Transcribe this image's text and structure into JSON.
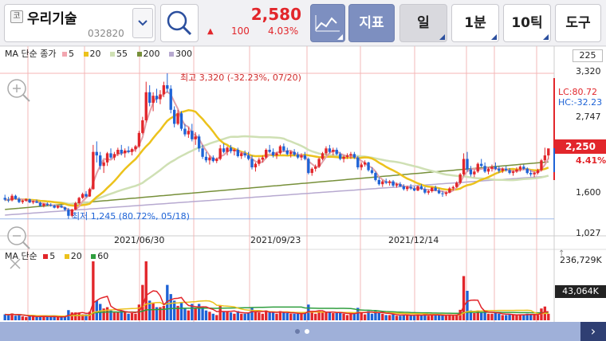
{
  "toolbar": {
    "market_badge": "코",
    "stock_name": "우리기술",
    "stock_code": "032820",
    "price": "2,580",
    "change_arrow": "▲",
    "change_value": "100",
    "change_percent": "4.03%",
    "indicator_label": "지표",
    "period_day_label": "일",
    "period_minute_label": "1분",
    "period_tick_label": "10틱",
    "tools_label": "도구"
  },
  "colors": {
    "up": "#e2262b",
    "down": "#1e63d6",
    "ma5": "#e3a0a8",
    "ma20": "#ecc21c",
    "ma55": "#cfe0b4",
    "ma200": "#77903a",
    "ma300": "#b7a9d0",
    "vma5": "#e2262b",
    "vma20": "#ecc21c",
    "vma60": "#2f9e3e"
  },
  "ma_legend": {
    "title": "MA 단순 종가",
    "items": [
      {
        "label": "5",
        "color": "#f2a6b0"
      },
      {
        "label": "20",
        "color": "#ecc21c"
      },
      {
        "label": "55",
        "color": "#cfe0b4"
      },
      {
        "label": "200",
        "color": "#77903a"
      },
      {
        "label": "300",
        "color": "#b7a9d0"
      }
    ]
  },
  "vol_legend": {
    "title": "MA 단순",
    "items": [
      {
        "label": "5",
        "color": "#e2262b"
      },
      {
        "label": "20",
        "color": "#ecc21c"
      },
      {
        "label": "60",
        "color": "#2f9e3e"
      }
    ]
  },
  "price_axis": {
    "top_value": "225",
    "ticks": [
      "3,320",
      "2,747",
      "1,600",
      "1,027"
    ],
    "current_price": "2,250",
    "current_percent": "4.41%",
    "lc_label": "LC:80.72",
    "hc_label": "HC:-32.23"
  },
  "volume_axis": {
    "max_value": "236,729K",
    "current_value": "43,064K"
  },
  "annotations": {
    "high": "최고 3,320 (-32.23%, 07/20)",
    "low": "최저 1,245 (80.72%, 05/18)"
  },
  "x_axis": {
    "labels": [
      "2021/06/30",
      "2021/09/23",
      "2021/12/14"
    ]
  },
  "chart_data": {
    "type": "candlestick",
    "price_range": [
      1027,
      3320
    ],
    "high": 3320,
    "low": 1245,
    "last_close": 2250,
    "candles": [
      [
        1545,
        1590,
        1500,
        1520
      ],
      [
        1520,
        1560,
        1480,
        1510
      ],
      [
        1510,
        1600,
        1495,
        1575
      ],
      [
        1575,
        1590,
        1520,
        1530
      ],
      [
        1530,
        1555,
        1470,
        1485
      ],
      [
        1485,
        1520,
        1460,
        1505
      ],
      [
        1505,
        1540,
        1490,
        1525
      ],
      [
        1525,
        1535,
        1470,
        1480
      ],
      [
        1480,
        1510,
        1455,
        1495
      ],
      [
        1495,
        1520,
        1470,
        1475
      ],
      [
        1475,
        1490,
        1420,
        1430
      ],
      [
        1430,
        1470,
        1410,
        1460
      ],
      [
        1460,
        1480,
        1430,
        1445
      ],
      [
        1445,
        1470,
        1420,
        1435
      ],
      [
        1435,
        1450,
        1395,
        1405
      ],
      [
        1405,
        1440,
        1390,
        1430
      ],
      [
        1430,
        1450,
        1400,
        1410
      ],
      [
        1410,
        1420,
        1360,
        1375
      ],
      [
        1375,
        1400,
        1245,
        1290
      ],
      [
        1290,
        1390,
        1270,
        1380
      ],
      [
        1380,
        1490,
        1370,
        1470
      ],
      [
        1470,
        1560,
        1450,
        1545
      ],
      [
        1545,
        1620,
        1530,
        1600
      ],
      [
        1600,
        1640,
        1550,
        1565
      ],
      [
        1565,
        1690,
        1560,
        1670
      ],
      [
        1670,
        2300,
        1660,
        2200
      ],
      [
        2200,
        2350,
        2050,
        2150
      ],
      [
        2150,
        2200,
        1950,
        2000
      ],
      [
        2000,
        2080,
        1900,
        2050
      ],
      [
        2050,
        2200,
        2000,
        2180
      ],
      [
        2180,
        2250,
        2100,
        2120
      ],
      [
        2120,
        2200,
        2080,
        2170
      ],
      [
        2170,
        2260,
        2140,
        2230
      ],
      [
        2230,
        2300,
        2150,
        2180
      ],
      [
        2180,
        2250,
        2120,
        2220
      ],
      [
        2220,
        2280,
        2180,
        2200
      ],
      [
        2200,
        2260,
        2150,
        2240
      ],
      [
        2240,
        2300,
        2200,
        2280
      ],
      [
        2280,
        2500,
        2260,
        2470
      ],
      [
        2470,
        2700,
        2450,
        2650
      ],
      [
        2650,
        3200,
        2620,
        3050
      ],
      [
        3050,
        3150,
        2850,
        2900
      ],
      [
        2900,
        3050,
        2780,
        3000
      ],
      [
        3000,
        3100,
        2900,
        2950
      ],
      [
        2950,
        3080,
        2880,
        3020
      ],
      [
        3020,
        3200,
        2980,
        3150
      ],
      [
        3150,
        3320,
        3050,
        3100
      ],
      [
        3100,
        3150,
        2750,
        2800
      ],
      [
        2800,
        2850,
        2550,
        2600
      ],
      [
        2600,
        2800,
        2580,
        2750
      ],
      [
        2750,
        2780,
        2500,
        2530
      ],
      [
        2530,
        2600,
        2420,
        2450
      ],
      [
        2450,
        2550,
        2400,
        2500
      ],
      [
        2500,
        2600,
        2350,
        2380
      ],
      [
        2380,
        2480,
        2300,
        2420
      ],
      [
        2420,
        2450,
        2200,
        2250
      ],
      [
        2250,
        2300,
        2100,
        2130
      ],
      [
        2130,
        2200,
        2050,
        2080
      ],
      [
        2080,
        2150,
        2020,
        2120
      ],
      [
        2120,
        2150,
        2050,
        2070
      ],
      [
        2070,
        2120,
        2040,
        2100
      ],
      [
        2100,
        2300,
        2080,
        2250
      ],
      [
        2250,
        2320,
        2180,
        2200
      ],
      [
        2200,
        2280,
        2150,
        2260
      ],
      [
        2260,
        2300,
        2180,
        2210
      ],
      [
        2210,
        2250,
        2150,
        2230
      ],
      [
        2230,
        2260,
        2120,
        2140
      ],
      [
        2140,
        2200,
        2100,
        2180
      ],
      [
        2180,
        2220,
        2120,
        2150
      ],
      [
        2150,
        2200,
        2080,
        2100
      ],
      [
        2100,
        2150,
        1950,
        1980
      ],
      [
        1980,
        2050,
        1920,
        2030
      ],
      [
        2030,
        2120,
        2000,
        2090
      ],
      [
        2090,
        2150,
        2050,
        2120
      ],
      [
        2120,
        2250,
        2100,
        2230
      ],
      [
        2230,
        2300,
        2180,
        2200
      ],
      [
        2200,
        2250,
        2120,
        2150
      ],
      [
        2150,
        2200,
        2100,
        2180
      ],
      [
        2180,
        2300,
        2160,
        2280
      ],
      [
        2280,
        2320,
        2200,
        2220
      ],
      [
        2220,
        2260,
        2150,
        2170
      ],
      [
        2170,
        2220,
        2120,
        2200
      ],
      [
        2200,
        2240,
        2140,
        2160
      ],
      [
        2160,
        2200,
        2100,
        2120
      ],
      [
        2120,
        2180,
        2080,
        2150
      ],
      [
        2150,
        2200,
        2080,
        2100
      ],
      [
        2100,
        2120,
        1880,
        1900
      ],
      [
        1900,
        1980,
        1860,
        1960
      ],
      [
        1960,
        2020,
        1920,
        1990
      ],
      [
        1990,
        2120,
        1970,
        2100
      ],
      [
        2100,
        2200,
        2080,
        2180
      ],
      [
        2180,
        2280,
        2150,
        2250
      ],
      [
        2250,
        2300,
        2180,
        2200
      ],
      [
        2200,
        2260,
        2150,
        2230
      ],
      [
        2230,
        2260,
        2150,
        2170
      ],
      [
        2170,
        2200,
        2080,
        2100
      ],
      [
        2100,
        2150,
        2050,
        2130
      ],
      [
        2130,
        2180,
        2100,
        2150
      ],
      [
        2150,
        2200,
        2100,
        2170
      ],
      [
        2170,
        2200,
        2100,
        2120
      ],
      [
        2120,
        2140,
        1950,
        1980
      ],
      [
        1980,
        2050,
        1940,
        2020
      ],
      [
        2020,
        2080,
        1990,
        2050
      ],
      [
        2050,
        2060,
        1920,
        1940
      ],
      [
        1940,
        1980,
        1880,
        1900
      ],
      [
        1900,
        1920,
        1780,
        1800
      ],
      [
        1800,
        1840,
        1720,
        1740
      ],
      [
        1740,
        1800,
        1700,
        1780
      ],
      [
        1780,
        1820,
        1740,
        1760
      ],
      [
        1760,
        1800,
        1720,
        1780
      ],
      [
        1780,
        1800,
        1700,
        1720
      ],
      [
        1720,
        1760,
        1690,
        1740
      ],
      [
        1740,
        1770,
        1700,
        1710
      ],
      [
        1710,
        1740,
        1650,
        1670
      ],
      [
        1670,
        1720,
        1640,
        1700
      ],
      [
        1700,
        1740,
        1660,
        1680
      ],
      [
        1680,
        1710,
        1640,
        1650
      ],
      [
        1650,
        1720,
        1640,
        1710
      ],
      [
        1710,
        1740,
        1660,
        1670
      ],
      [
        1670,
        1700,
        1600,
        1620
      ],
      [
        1620,
        1660,
        1590,
        1640
      ],
      [
        1640,
        1700,
        1620,
        1690
      ],
      [
        1690,
        1720,
        1640,
        1650
      ],
      [
        1650,
        1680,
        1600,
        1610
      ],
      [
        1610,
        1640,
        1560,
        1600
      ],
      [
        1600,
        1640,
        1570,
        1620
      ],
      [
        1620,
        1700,
        1610,
        1680
      ],
      [
        1680,
        1720,
        1650,
        1700
      ],
      [
        1700,
        1780,
        1690,
        1760
      ],
      [
        1760,
        1900,
        1740,
        1880
      ],
      [
        1880,
        2180,
        1860,
        2100
      ],
      [
        2100,
        2200,
        1920,
        1950
      ],
      [
        1950,
        2000,
        1850,
        1880
      ],
      [
        1880,
        1950,
        1840,
        1920
      ],
      [
        1920,
        2050,
        1900,
        2030
      ],
      [
        2030,
        2100,
        1980,
        2000
      ],
      [
        2000,
        2050,
        1900,
        1920
      ],
      [
        1920,
        1980,
        1880,
        1960
      ],
      [
        1960,
        2020,
        1920,
        1990
      ],
      [
        1990,
        2050,
        1940,
        1960
      ],
      [
        1960,
        2000,
        1900,
        1930
      ],
      [
        1930,
        1980,
        1900,
        1960
      ],
      [
        1960,
        2000,
        1920,
        1940
      ],
      [
        1940,
        1970,
        1880,
        1900
      ],
      [
        1900,
        1940,
        1860,
        1920
      ],
      [
        1920,
        1980,
        1900,
        1950
      ],
      [
        1950,
        2010,
        1920,
        1990
      ],
      [
        1990,
        2020,
        1940,
        1960
      ],
      [
        1960,
        1980,
        1880,
        1900
      ],
      [
        1900,
        1940,
        1850,
        1880
      ],
      [
        1880,
        1920,
        1840,
        1900
      ],
      [
        1900,
        1960,
        1880,
        1940
      ],
      [
        1940,
        2100,
        1920,
        2080
      ],
      [
        2080,
        2260,
        2050,
        2150
      ],
      [
        2150,
        2200,
        2100,
        2250
      ]
    ],
    "ma": {
      "5": "price short average (pink)",
      "20": "yellow",
      "55": "light green",
      "200": "olive",
      "300": "lavender"
    },
    "volume_max_k": 236729,
    "volume_current_k": 43064,
    "x_labels": [
      "2021/06/30",
      "2021/09/23",
      "2021/12/14"
    ]
  }
}
